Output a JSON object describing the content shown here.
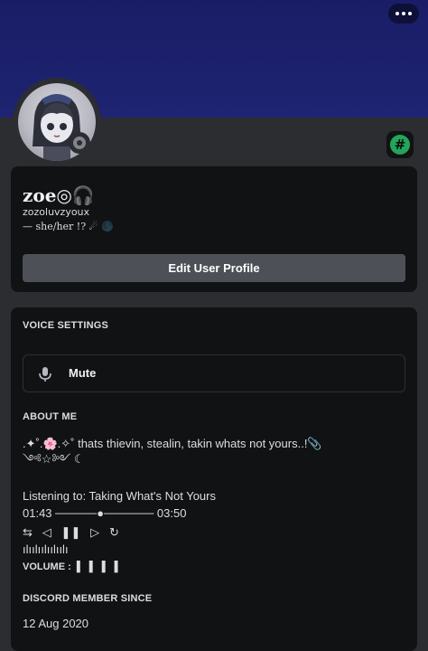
{
  "header": {
    "more_icon": "more-horizontal-icon",
    "banner_color": "#1e2472"
  },
  "profile": {
    "display_name": "zoe◎🎧",
    "username": "zozoluvzyoux",
    "pronouns": "—    she/her      !? ☄︎ 🌑",
    "status": "offline",
    "badge_icon": "hashtag-badge-icon",
    "badge_color": "#23a55a",
    "edit_button_label": "Edit User Profile"
  },
  "voice_settings": {
    "heading": "VOICE SETTINGS",
    "mute_label": "Mute",
    "mic_icon": "microphone-icon"
  },
  "about_me": {
    "heading": "ABOUT ME",
    "line1": ".✦˚.🌸.✧˚ thats thievin, stealin, takin whats not yours..!📎",
    "line2": "༺☆༻ ☾",
    "line3": "Listening to: Taking What's Not Yours",
    "line4": "01:43 ─────●────── 03:50",
    "line5": "⇆   ◁   ❚❚   ▷   ↻",
    "line6": "ılıılıılıılıılı",
    "line7": "VOLUME :  ▌  ▌  ▌  ▌"
  },
  "member_since": {
    "heading": "DISCORD MEMBER SINCE",
    "date": "12 Aug 2020"
  }
}
